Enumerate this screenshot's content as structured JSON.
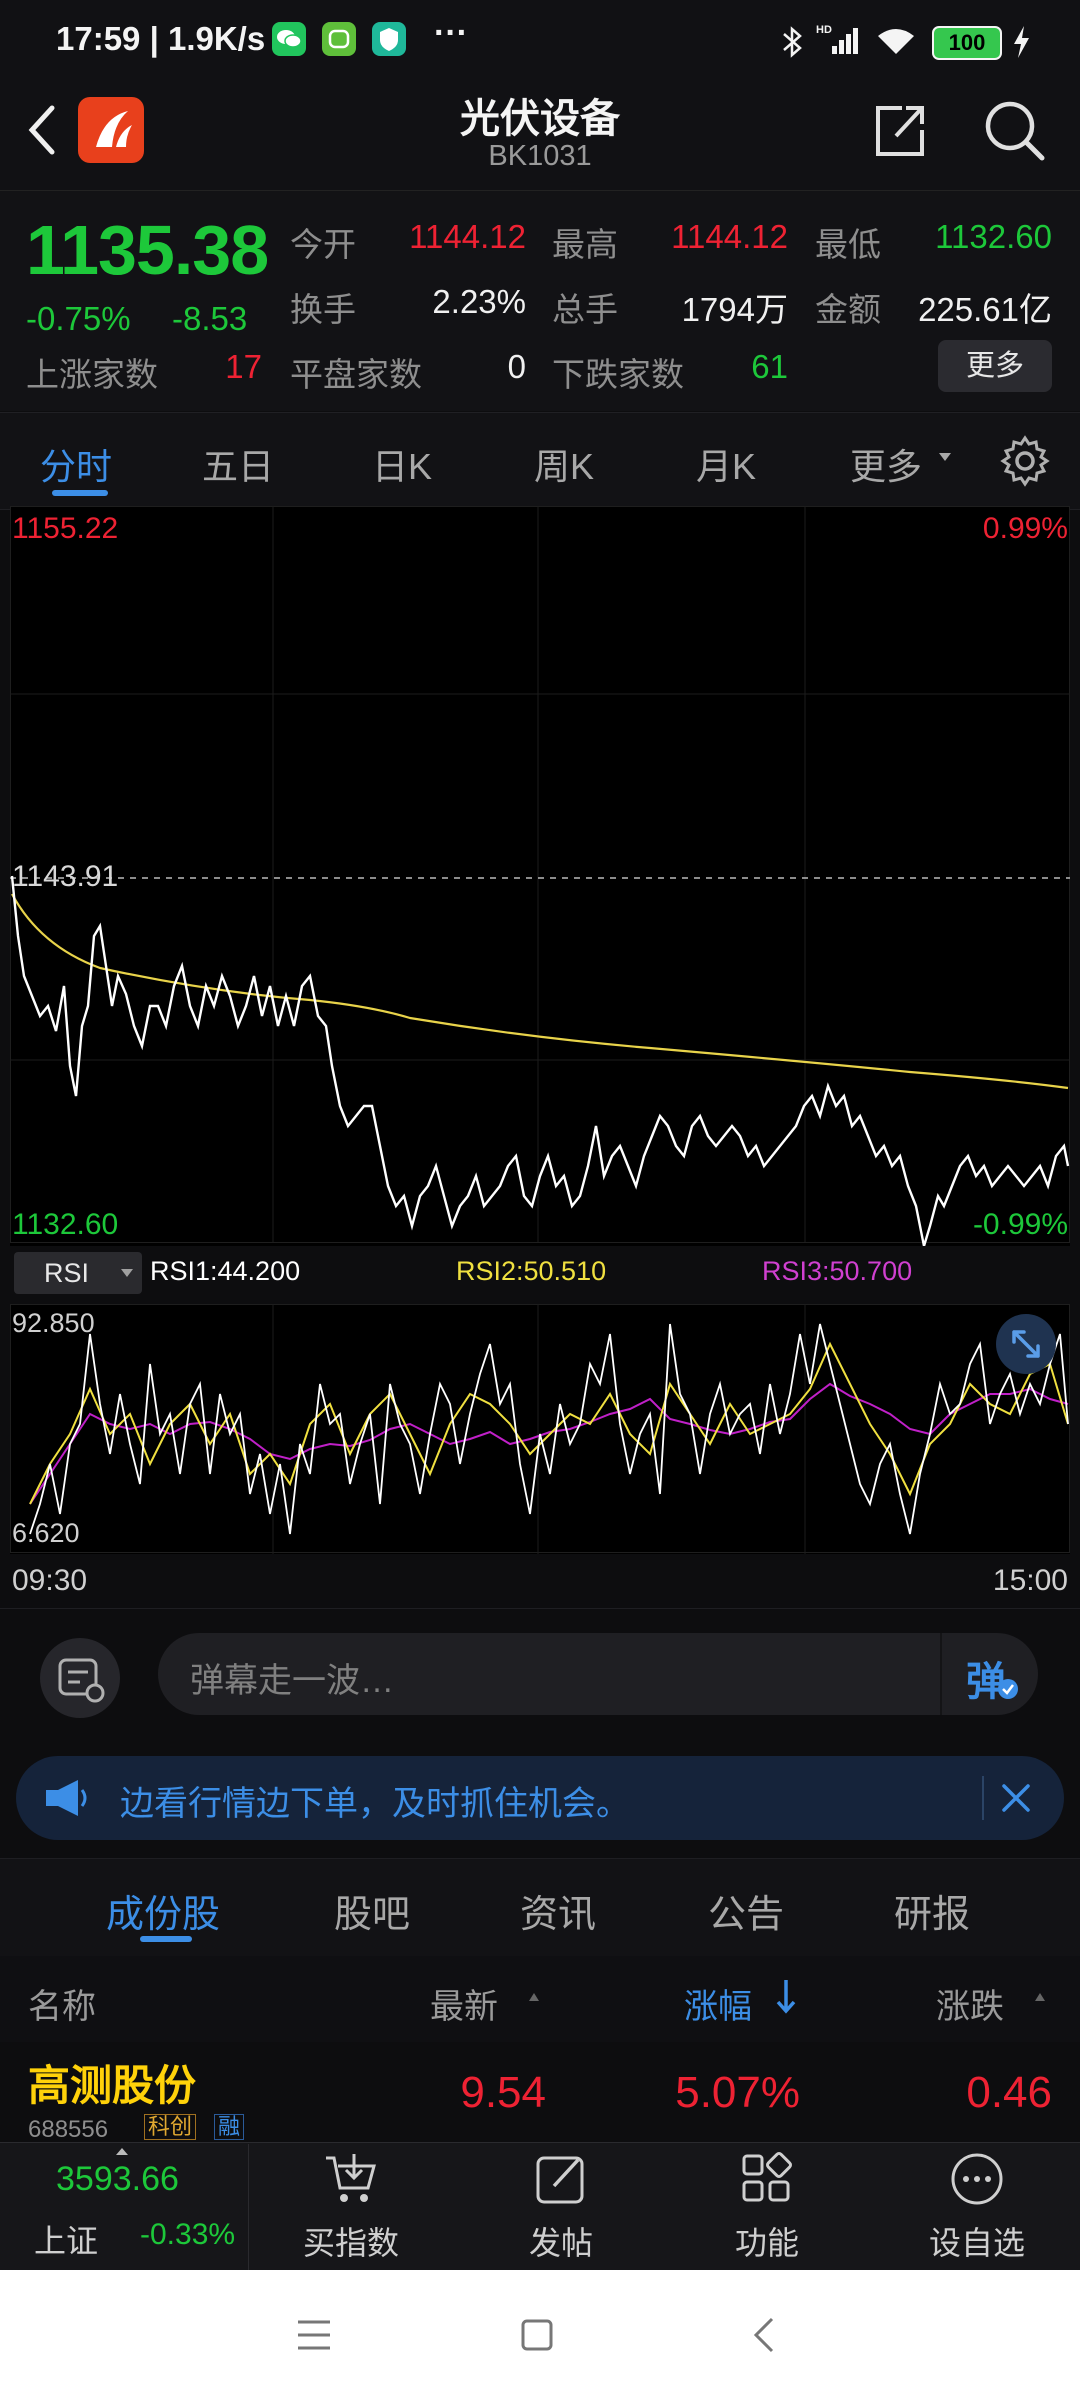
{
  "status_bar": {
    "time": "17:59 | 1.9K/s",
    "more": "···",
    "signal_label": "HD",
    "battery": "100"
  },
  "header": {
    "title": "光伏设备",
    "code": "BK1031"
  },
  "quote": {
    "price": "1135.38",
    "change_pct": "-0.75%",
    "change": "-8.53",
    "rows": [
      [
        {
          "label": "今开",
          "value": "1144.12",
          "color": "#ee2233"
        },
        {
          "label": "最高",
          "value": "1144.12",
          "color": "#ee2233"
        },
        {
          "label": "最低",
          "value": "1132.60",
          "color": "#1dc83a"
        }
      ],
      [
        {
          "label": "换手",
          "value": "2.23%",
          "color": "#f0f0f0"
        },
        {
          "label": "总手",
          "value": "1794万",
          "color": "#f0f0f0"
        },
        {
          "label": "金额",
          "value": "225.61亿",
          "color": "#f0f0f0"
        }
      ]
    ],
    "rising_label": "上涨家数",
    "rising": "17",
    "flat_label": "平盘家数",
    "flat": "0",
    "falling_label": "下跌家数",
    "falling": "61",
    "more_button": "更多"
  },
  "tabs": [
    "分时",
    "五日",
    "日K",
    "周K",
    "月K",
    "更多"
  ],
  "chart": {
    "price_high": "1155.22",
    "pct_high": "0.99%",
    "prev_close": "1143.91",
    "price_low": "1132.60",
    "pct_low": "-0.99%",
    "indicator": "RSI",
    "rsi1": "RSI1:44.200",
    "rsi2": "RSI2:50.510",
    "rsi3": "RSI3:50.700",
    "rsi_max": "92.850",
    "rsi_min": "6.620",
    "time_start": "09:30",
    "time_end": "15:00",
    "colors": {
      "price": "#ffffff",
      "avg": "#e8d34a",
      "rsi1": "#ffffff",
      "rsi2": "#f0e040",
      "rsi3": "#c020c8"
    }
  },
  "danmu": {
    "placeholder": "弹幕走一波…",
    "send_label": "弹"
  },
  "banner": {
    "text": "边看行情边下单，及时抓住机会。"
  },
  "section_tabs": [
    "成份股",
    "股吧",
    "资讯",
    "公告",
    "研报"
  ],
  "table": {
    "headers": {
      "name": "名称",
      "latest": "最新",
      "pct": "涨幅",
      "change": "涨跌"
    },
    "rows": [
      {
        "name": "高测股份",
        "code": "688556",
        "tag1": "科创",
        "tag2": "融",
        "latest": "9.54",
        "pct": "5.07%",
        "change": "0.46"
      }
    ]
  },
  "toolbar": {
    "index_value": "3593.66",
    "index_name": "上证",
    "index_pct": "-0.33%",
    "items": [
      "买指数",
      "发帖",
      "功能",
      "设自选"
    ]
  }
}
